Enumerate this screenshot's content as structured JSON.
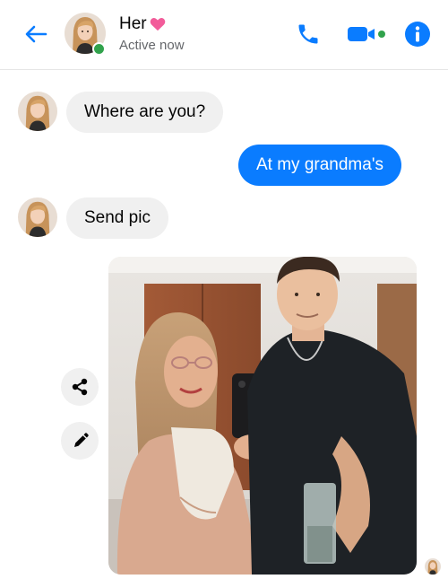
{
  "header": {
    "contact_name": "Her",
    "status": "Active now",
    "accent_color": "#0a7cff",
    "heart_color": "#f25c9a",
    "active_color": "#31a24c",
    "icons": [
      "back-arrow-icon",
      "phone-icon",
      "video-camera-icon",
      "info-icon"
    ]
  },
  "messages": [
    {
      "from": "her",
      "text": "Where are you?"
    },
    {
      "from": "me",
      "text": "At my grandma's"
    },
    {
      "from": "her",
      "text": "Send pic"
    },
    {
      "from": "me",
      "type": "photo"
    }
  ],
  "photo_actions": [
    "share-icon",
    "edit-pencil-icon"
  ]
}
